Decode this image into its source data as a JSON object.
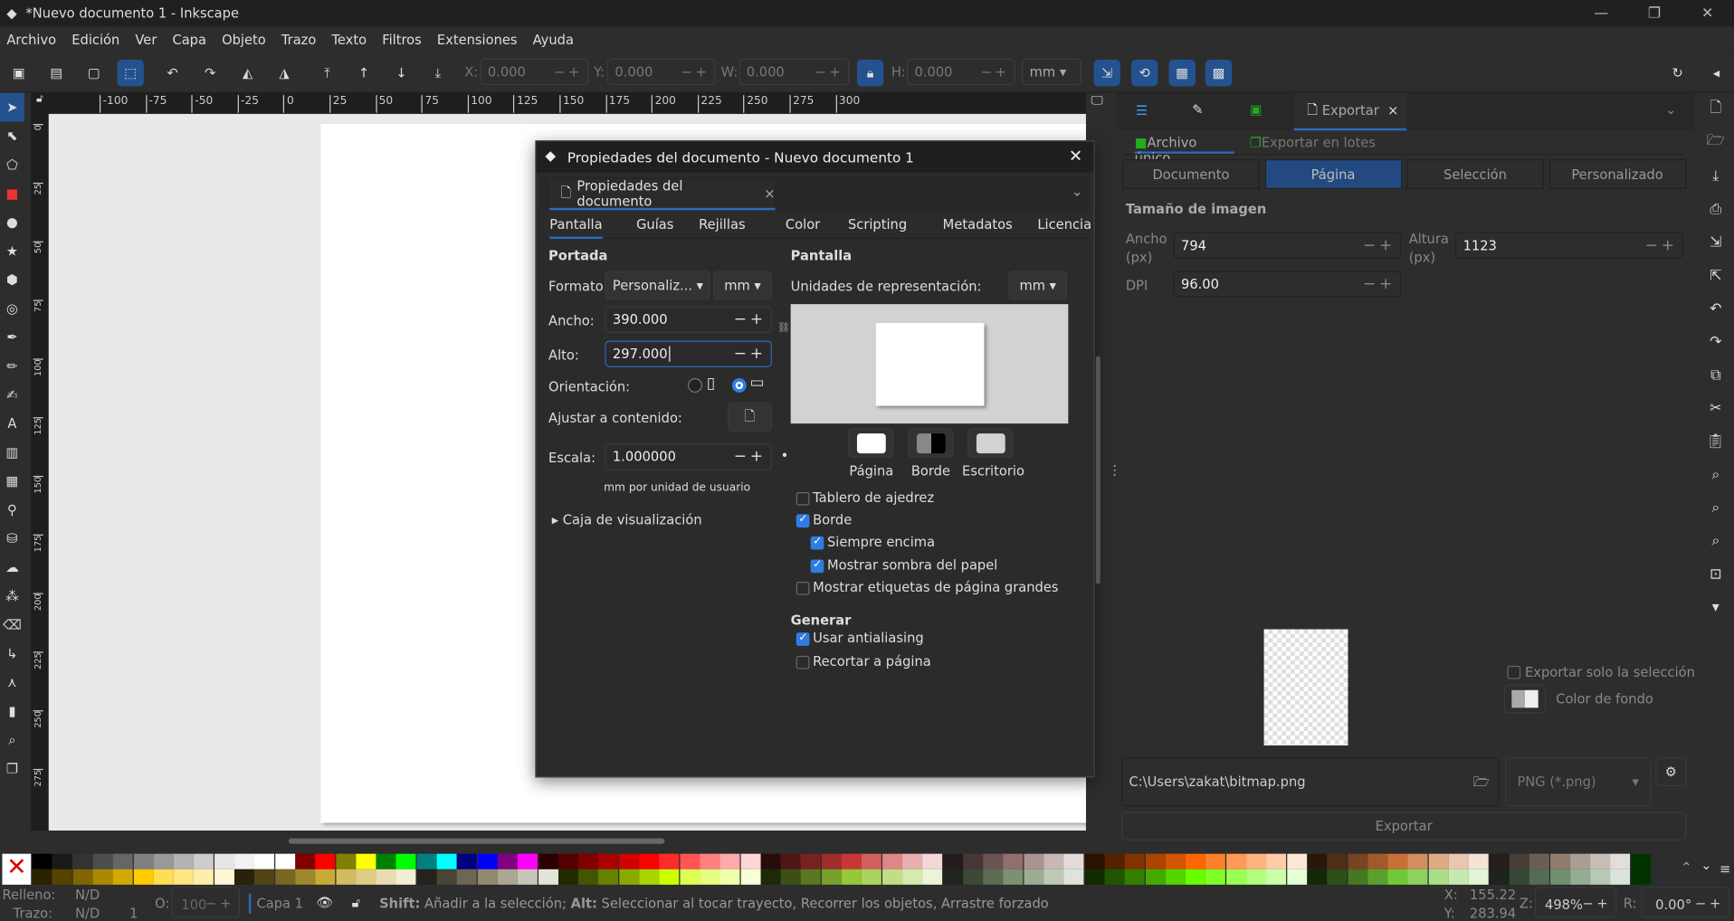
{
  "window": {
    "title": "*Nuevo documento 1 - Inkscape",
    "minimize": "—",
    "maximize": "❐",
    "close": "✕"
  },
  "menu": [
    "Archivo",
    "Edición",
    "Ver",
    "Capa",
    "Objeto",
    "Trazo",
    "Texto",
    "Filtros",
    "Extensiones",
    "Ayuda"
  ],
  "toolbar": {
    "x_label": "X:",
    "x": "0.000",
    "y_label": "Y:",
    "y": "0.000",
    "w_label": "W:",
    "w": "0.000",
    "h_label": "H:",
    "h": "0.000",
    "unit": "mm"
  },
  "ruler_ticks": [
    "-100",
    "-75",
    "-50",
    "-25",
    "0",
    "25",
    "50",
    "75",
    "100",
    "125",
    "150",
    "175",
    "200",
    "225",
    "250",
    "275",
    "300"
  ],
  "ruler_v_ticks": [
    "0",
    "25",
    "50",
    "75",
    "100",
    "125",
    "150",
    "175",
    "200",
    "225",
    "250",
    "275"
  ],
  "dialog": {
    "title": "Propiedades del documento - Nuevo documento 1",
    "tab": "Propiedades del documento",
    "subtabs": [
      "Pantalla",
      "Guías",
      "Rejillas",
      "Color",
      "Scripting",
      "Metadatos",
      "Licencia"
    ],
    "active_subtab": "Pantalla",
    "portada": "Portada",
    "formato_label": "Formato:",
    "formato": "Personaliz...",
    "formato_unit": "mm",
    "ancho_label": "Ancho:",
    "ancho": "390.000",
    "alto_label": "Alto:",
    "alto": "297.000",
    "orientacion_label": "Orientación:",
    "orientation": "landscape",
    "ajustar_label": "Ajustar a contenido:",
    "escala_label": "Escala:",
    "escala": "1.000000",
    "escala_hint": "mm por unidad de usuario",
    "viewbox": "Caja de visualización",
    "pantalla": "Pantalla",
    "unidades_label": "Unidades de representación:",
    "unidades": "mm",
    "color_buttons": [
      "Página",
      "Borde",
      "Escritorio"
    ],
    "checks": [
      {
        "label": "Tablero de ajedrez",
        "checked": false
      },
      {
        "label": "Borde",
        "checked": true
      },
      {
        "label": "Siempre encima",
        "checked": true
      },
      {
        "label": "Mostrar sombra del papel",
        "checked": true
      },
      {
        "label": "Mostrar etiquetas de página grandes",
        "checked": false
      }
    ],
    "generar": "Generar",
    "checks2": [
      {
        "label": "Usar antialiasing",
        "checked": true
      },
      {
        "label": "Recortar a página",
        "checked": false
      }
    ]
  },
  "export": {
    "tab": "Exportar",
    "modes": [
      "Archivo único",
      "Exportar en lotes"
    ],
    "areas": [
      "Documento",
      "Página",
      "Selección",
      "Personalizado"
    ],
    "active_area": "Página",
    "size_title": "Tamaño de imagen",
    "ancho_label": "Ancho\n(px)",
    "ancho": "794",
    "altura_label": "Altura\n(px)",
    "altura": "1123",
    "dpi_label": "DPI",
    "dpi": "96.00",
    "only_selection": "Exportar solo la selección",
    "bg_color": "Color de fondo",
    "path": "C:\\Users\\zakat\\bitmap.png",
    "format": "PNG (*.png)",
    "export_button": "Exportar"
  },
  "status": {
    "fill_label": "Relleno:",
    "fill": "N/D",
    "stroke_label": "Trazo:",
    "stroke": "N/D",
    "stroke_width": "1",
    "opacity_label": "O:",
    "opacity": "100",
    "layer": "Capa 1",
    "msg_shift": "Shift:",
    "msg1": " Añadir a la selección; ",
    "msg_alt": "Alt:",
    "msg2": " Seleccionar al tocar trayecto, Recorrer los objetos, Arrastre forzado",
    "x_label": "X:",
    "x": "155.22",
    "y_label": "Y:",
    "y": "283.94",
    "zoom_label": "Z:",
    "zoom": "498%",
    "rot_label": "R:",
    "rotation": "0.00°"
  },
  "palette_top": [
    "#000000",
    "#1a1a1a",
    "#333333",
    "#4d4d4d",
    "#666666",
    "#808080",
    "#999999",
    "#b3b3b3",
    "#cccccc",
    "#e6e6e6",
    "#f2f2f2",
    "#ffffff",
    "#ffffff",
    "#800000",
    "#ff0000",
    "#808000",
    "#ffff00",
    "#008000",
    "#00ff00",
    "#008080",
    "#00ffff",
    "#000080",
    "#0000ff",
    "#800080",
    "#ff00ff",
    "#2b0000",
    "#550000",
    "#800000",
    "#aa0000",
    "#d40000",
    "#ff0000",
    "#ff2a2a",
    "#ff5555",
    "#ff8080",
    "#ffaaaa",
    "#ffd5d5",
    "#280b0b",
    "#501616",
    "#782121",
    "#a02c2c",
    "#c83737",
    "#d35f5f",
    "#de8787",
    "#e9afaf",
    "#f4d7d7",
    "#241c1c",
    "#483737",
    "#6c5353",
    "#916f6f",
    "#ac9393",
    "#c8b7b7",
    "#e3dbdb",
    "#2b1100",
    "#552200",
    "#803300",
    "#aa4400",
    "#d45500",
    "#ff6600",
    "#ff7f2a",
    "#ff9955",
    "#ffb380",
    "#ffccaa",
    "#ffe6d5",
    "#28170b",
    "#502d16",
    "#784421",
    "#a05a2c",
    "#c87137",
    "#d38d5f",
    "#deaa87",
    "#e9c6af",
    "#f4e3d7",
    "#241f1c",
    "#483e37",
    "#6c5d53",
    "#917c6f",
    "#ac9d93",
    "#c8beb7",
    "#e3dedb",
    "#003300"
  ],
  "palette_bottom": [
    "#2b2200",
    "#554400",
    "#806600",
    "#aa8800",
    "#d4aa00",
    "#ffcc00",
    "#ffdd55",
    "#ffe680",
    "#ffeeaa",
    "#fff6d5",
    "#28220b",
    "#504416",
    "#786721",
    "#a0892c",
    "#c8ab37",
    "#d3bc5f",
    "#decd87",
    "#e9ddaf",
    "#f4eed7",
    "#24221c",
    "#484537",
    "#6c6753",
    "#918a6f",
    "#aca793",
    "#c8c4b7",
    "#e3e2db",
    "#222b00",
    "#445500",
    "#668000",
    "#88aa00",
    "#aad400",
    "#ccff00",
    "#ddff55",
    "#e5ff80",
    "#eeffaa",
    "#f6ffd5",
    "#1e280b",
    "#3c5016",
    "#5a7821",
    "#78a02c",
    "#96c837",
    "#abd35f",
    "#c1de87",
    "#d6e9af",
    "#ebf4d7",
    "#1f241c",
    "#3e4837",
    "#5d6c53",
    "#7c916f",
    "#9dac93",
    "#bec8b7",
    "#dee3db",
    "#112b00",
    "#225500",
    "#338000",
    "#44aa00",
    "#55d400",
    "#66ff00",
    "#7fff2a",
    "#99ff55",
    "#b3ff80",
    "#ccffaa",
    "#e5ffd5",
    "#172808",
    "#2d5016",
    "#447821",
    "#5aa02c",
    "#71c837",
    "#8dd35f",
    "#aade87",
    "#c6e9af",
    "#e3f4d7",
    "#1c241c",
    "#374837",
    "#536c53",
    "#6f916f",
    "#93ac93",
    "#b7c8b7",
    "#dbe3db",
    "#003300"
  ],
  "accent": "#24528f"
}
